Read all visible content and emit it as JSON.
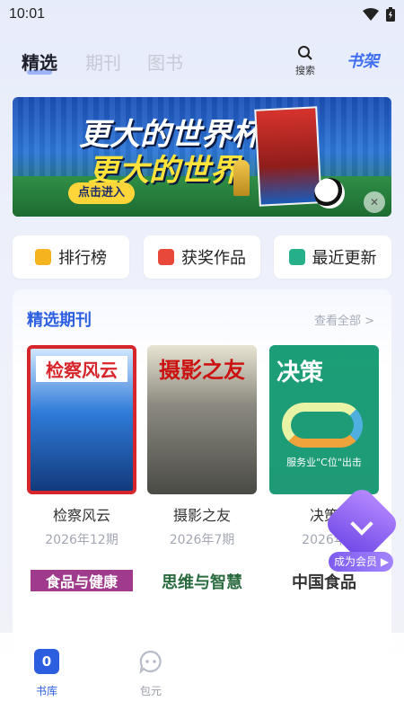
{
  "status_bar": {
    "time": "10:01"
  },
  "top_nav": {
    "tabs": [
      {
        "label": "精选",
        "active": true
      },
      {
        "label": "期刊",
        "active": false
      },
      {
        "label": "图书",
        "active": false
      }
    ],
    "search_label": "搜索",
    "shelf_label": "书架"
  },
  "banner": {
    "line1": "更大的世界杯,",
    "line2": "更大的世界",
    "button": "点击进入"
  },
  "quick_links": [
    {
      "label": "排行榜",
      "icon": "ranking-icon",
      "color": "#f5b31e"
    },
    {
      "label": "获奖作品",
      "icon": "award-icon",
      "color": "#e8483a"
    },
    {
      "label": "最近更新",
      "icon": "update-book-icon",
      "color": "#25b08a"
    }
  ],
  "featured": {
    "title": "精选期刊",
    "see_all": "查看全部 >",
    "magazines": [
      {
        "title": "检察风云",
        "issue": "2026年12期",
        "cover_title": "检察风云"
      },
      {
        "title": "摄影之友",
        "issue": "2026年7期",
        "cover_title": "摄影之友"
      },
      {
        "title": "决策",
        "issue": "2026年",
        "cover_title": "决策",
        "cover_sub": "服务业\"C位\"出击"
      }
    ],
    "row2": [
      {
        "cover_title": "食品与健康"
      },
      {
        "cover_title": "思维与智慧"
      },
      {
        "cover_title": "中国食品"
      }
    ]
  },
  "vip": {
    "label": "成为会员 ▶"
  },
  "bottom_nav": {
    "items": [
      {
        "label": "书库",
        "active": true,
        "badge": "0"
      },
      {
        "label": "包元",
        "active": false
      }
    ]
  },
  "colors": {
    "accent": "#2c5fe0",
    "background": "#eef1fb"
  }
}
